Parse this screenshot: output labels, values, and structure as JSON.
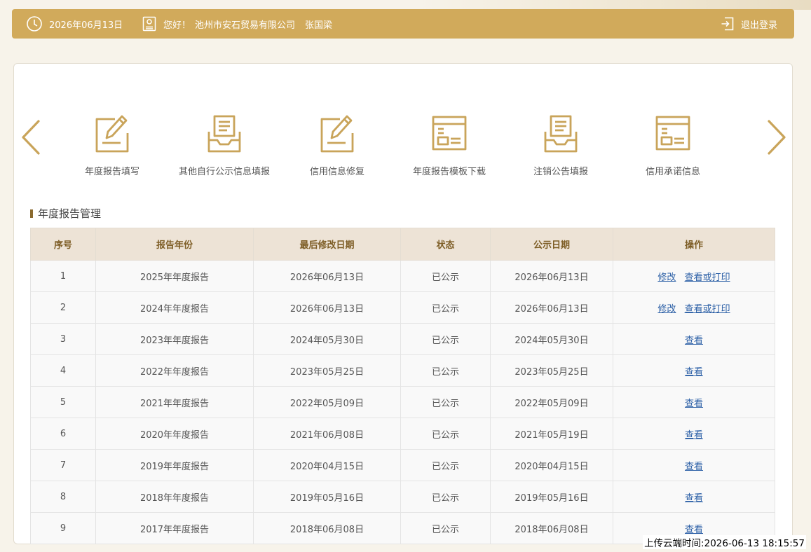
{
  "topbar": {
    "date": "2026年06月13日",
    "greeting": "您好！",
    "company": "池州市安石贸易有限公司",
    "user": "张国梁",
    "logout_label": "退出登录",
    "icons": [
      "clock-icon",
      "user-badge-icon",
      "logout-icon"
    ]
  },
  "quick_links": [
    {
      "label": "年度报告填写",
      "icon": "edit-icon"
    },
    {
      "label": "其他自行公示信息填报",
      "icon": "inbox-icon"
    },
    {
      "label": "信用信息修复",
      "icon": "edit-icon"
    },
    {
      "label": "年度报告模板下载",
      "icon": "template-icon"
    },
    {
      "label": "注销公告填报",
      "icon": "inbox-icon"
    },
    {
      "label": "信用承诺信息",
      "icon": "template-icon"
    }
  ],
  "section": {
    "title": "年度报告管理"
  },
  "table": {
    "headers": [
      "序号",
      "报告年份",
      "最后修改日期",
      "状态",
      "公示日期",
      "操作"
    ],
    "action_labels": {
      "edit": "修改",
      "view_print": "查看或打印",
      "view": "查看"
    },
    "rows": [
      {
        "no": "1",
        "year": "2025年年度报告",
        "modified": "2026年06月13日",
        "status": "已公示",
        "published": "2026年06月13日"
      },
      {
        "no": "2",
        "year": "2024年年度报告",
        "modified": "2026年06月13日",
        "status": "已公示",
        "published": "2026年06月13日"
      },
      {
        "no": "3",
        "year": "2023年年度报告",
        "modified": "2024年05月30日",
        "status": "已公示",
        "published": "2024年05月30日"
      },
      {
        "no": "4",
        "year": "2022年年度报告",
        "modified": "2023年05月25日",
        "status": "已公示",
        "published": "2023年05月25日"
      },
      {
        "no": "5",
        "year": "2021年年度报告",
        "modified": "2022年05月09日",
        "status": "已公示",
        "published": "2022年05月09日"
      },
      {
        "no": "6",
        "year": "2020年年度报告",
        "modified": "2021年06月08日",
        "status": "已公示",
        "published": "2021年05月19日"
      },
      {
        "no": "7",
        "year": "2019年年度报告",
        "modified": "2020年04月15日",
        "status": "已公示",
        "published": "2020年04月15日"
      },
      {
        "no": "8",
        "year": "2018年年度报告",
        "modified": "2019年05月16日",
        "status": "已公示",
        "published": "2019年05月16日"
      },
      {
        "no": "9",
        "year": "2017年年度报告",
        "modified": "2018年06月08日",
        "status": "已公示",
        "published": "2018年06月08日"
      }
    ]
  },
  "footer": {
    "upload_time": "上传云端时间:2026-06-13 18:15:57"
  },
  "colors": {
    "accent": "#d1aa5b",
    "header_bg": "#ede3d6",
    "header_text": "#7d5d25",
    "link": "#2b5fa6"
  }
}
